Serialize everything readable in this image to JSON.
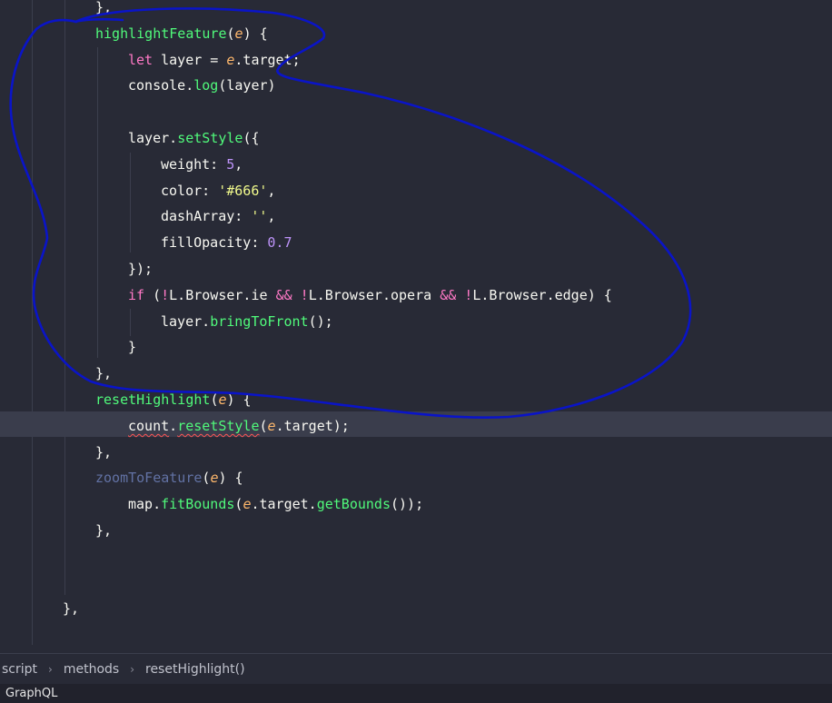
{
  "editor": {
    "lines": [
      {
        "indent": 3,
        "tokens": [
          {
            "c": "",
            "t": "},"
          }
        ]
      },
      {
        "indent": 3,
        "tokens": [
          {
            "c": "fn",
            "t": "highlightFeature"
          },
          {
            "c": "",
            "t": "("
          },
          {
            "c": "param",
            "t": "e"
          },
          {
            "c": "",
            "t": ") {"
          }
        ]
      },
      {
        "indent": 4,
        "tokens": [
          {
            "c": "kw",
            "t": "let"
          },
          {
            "c": "",
            "t": " layer = "
          },
          {
            "c": "param",
            "t": "e"
          },
          {
            "c": "",
            "t": ".target;"
          }
        ]
      },
      {
        "indent": 4,
        "tokens": [
          {
            "c": "",
            "t": "console."
          },
          {
            "c": "fn",
            "t": "log"
          },
          {
            "c": "",
            "t": "(layer)"
          }
        ]
      },
      {
        "indent": 0,
        "tokens": []
      },
      {
        "indent": 4,
        "tokens": [
          {
            "c": "",
            "t": "layer."
          },
          {
            "c": "fn",
            "t": "setStyle"
          },
          {
            "c": "",
            "t": "({"
          }
        ]
      },
      {
        "indent": 5,
        "tokens": [
          {
            "c": "",
            "t": "weight: "
          },
          {
            "c": "num",
            "t": "5"
          },
          {
            "c": "",
            "t": ","
          }
        ]
      },
      {
        "indent": 5,
        "tokens": [
          {
            "c": "",
            "t": "color: "
          },
          {
            "c": "str",
            "t": "'#666'"
          },
          {
            "c": "",
            "t": ","
          }
        ]
      },
      {
        "indent": 5,
        "tokens": [
          {
            "c": "",
            "t": "dashArray: "
          },
          {
            "c": "str",
            "t": "''"
          },
          {
            "c": "",
            "t": ","
          }
        ]
      },
      {
        "indent": 5,
        "tokens": [
          {
            "c": "",
            "t": "fillOpacity: "
          },
          {
            "c": "num",
            "t": "0.7"
          }
        ]
      },
      {
        "indent": 4,
        "tokens": [
          {
            "c": "",
            "t": "});"
          }
        ]
      },
      {
        "indent": 4,
        "tokens": [
          {
            "c": "kw",
            "t": "if"
          },
          {
            "c": "",
            "t": " ("
          },
          {
            "c": "kw",
            "t": "!"
          },
          {
            "c": "",
            "t": "L.Browser.ie "
          },
          {
            "c": "kw",
            "t": "&&"
          },
          {
            "c": "",
            "t": " "
          },
          {
            "c": "kw",
            "t": "!"
          },
          {
            "c": "",
            "t": "L.Browser.opera "
          },
          {
            "c": "kw",
            "t": "&&"
          },
          {
            "c": "",
            "t": " "
          },
          {
            "c": "kw",
            "t": "!"
          },
          {
            "c": "",
            "t": "L.Browser.edge) {"
          }
        ]
      },
      {
        "indent": 5,
        "tokens": [
          {
            "c": "",
            "t": "layer."
          },
          {
            "c": "fn",
            "t": "bringToFront"
          },
          {
            "c": "",
            "t": "();"
          }
        ]
      },
      {
        "indent": 4,
        "tokens": [
          {
            "c": "",
            "t": "}"
          }
        ]
      },
      {
        "indent": 3,
        "tokens": [
          {
            "c": "",
            "t": "},"
          }
        ]
      },
      {
        "indent": 3,
        "tokens": [
          {
            "c": "fn",
            "t": "resetHighlight"
          },
          {
            "c": "",
            "t": "("
          },
          {
            "c": "param",
            "t": "e"
          },
          {
            "c": "",
            "t": ") {"
          }
        ]
      },
      {
        "indent": 4,
        "tokens": [
          {
            "c": "squiggle",
            "t": "count"
          },
          {
            "c": "",
            "t": "."
          },
          {
            "c": "fn squiggle",
            "t": "resetStyle"
          },
          {
            "c": "",
            "t": "("
          },
          {
            "c": "param",
            "t": "e"
          },
          {
            "c": "",
            "t": ".target);"
          }
        ]
      },
      {
        "indent": 3,
        "tokens": [
          {
            "c": "",
            "t": "},"
          }
        ]
      },
      {
        "indent": 3,
        "tokens": [
          {
            "c": "faded",
            "t": "zoomToFeature"
          },
          {
            "c": "",
            "t": "("
          },
          {
            "c": "param",
            "t": "e"
          },
          {
            "c": "",
            "t": ") {"
          }
        ]
      },
      {
        "indent": 4,
        "tokens": [
          {
            "c": "",
            "t": "map."
          },
          {
            "c": "fn",
            "t": "fitBounds"
          },
          {
            "c": "",
            "t": "("
          },
          {
            "c": "param",
            "t": "e"
          },
          {
            "c": "",
            "t": ".target."
          },
          {
            "c": "fn",
            "t": "getBounds"
          },
          {
            "c": "",
            "t": "());"
          }
        ]
      },
      {
        "indent": 3,
        "tokens": [
          {
            "c": "",
            "t": "},"
          }
        ]
      },
      {
        "indent": 0,
        "tokens": []
      },
      {
        "indent": 0,
        "tokens": []
      },
      {
        "indent": 2,
        "tokens": [
          {
            "c": "",
            "t": "},"
          }
        ]
      }
    ]
  },
  "breadcrumb": {
    "items": [
      "script",
      "methods",
      "resetHighlight()"
    ],
    "separator": "›"
  },
  "statusbar": {
    "language": "GraphQL"
  },
  "annotation": {
    "description": "hand-drawn blue freehand loop",
    "color": "#0a14c8"
  }
}
